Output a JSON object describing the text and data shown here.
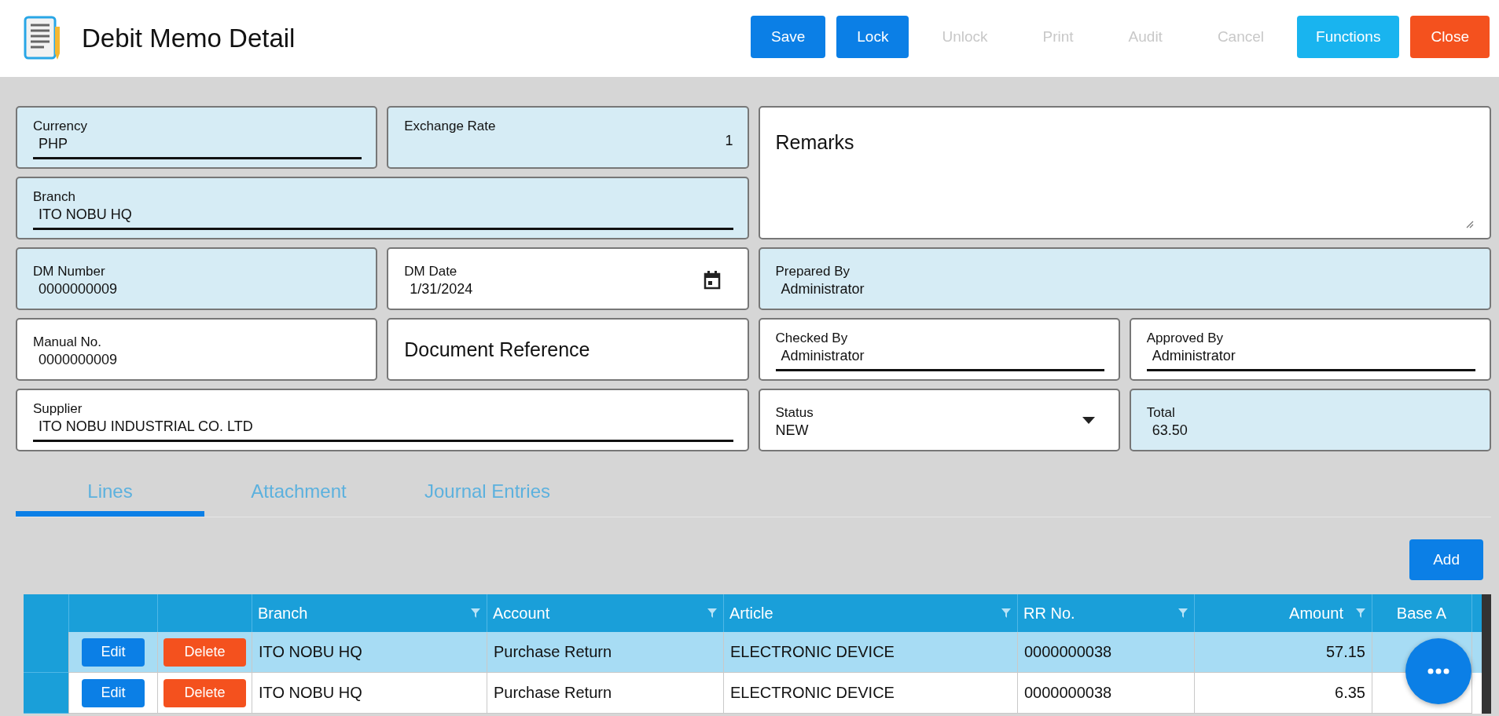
{
  "window": {
    "title": "Debit Memo Detail"
  },
  "toolbar": [
    {
      "label": "Save",
      "disabled": false
    },
    {
      "label": "Lock",
      "disabled": false
    },
    {
      "label": "Unlock",
      "disabled": true
    },
    {
      "label": "Print",
      "disabled": true
    },
    {
      "label": "Audit",
      "disabled": true
    },
    {
      "label": "Cancel",
      "disabled": true
    },
    {
      "label": "Functions",
      "disabled": false
    },
    {
      "label": "Close",
      "disabled": false
    }
  ],
  "fields": [
    {
      "kind": "input",
      "label": "Currency",
      "value": "PHP",
      "readonly": true
    },
    {
      "kind": "number",
      "label": "Exchange Rate",
      "value": "1",
      "readonly": true
    },
    {
      "kind": "textarea",
      "placeholder": "Remarks",
      "readonly": false
    },
    {
      "kind": "input",
      "label": "Branch",
      "value": "ITO NOBU HQ",
      "readonly": true
    },
    {
      "kind": "display",
      "label": "DM Number",
      "value": "0000000009",
      "readonly": true
    },
    {
      "kind": "date",
      "label": "DM Date",
      "value": "1/31/2024",
      "readonly": false
    },
    {
      "kind": "display",
      "label": "Prepared By",
      "value": "Administrator",
      "readonly": true
    },
    {
      "kind": "display",
      "label": "Manual No.",
      "value": "0000000009",
      "readonly": false
    },
    {
      "kind": "empty",
      "placeholder": "Document Reference",
      "readonly": false
    },
    {
      "kind": "input",
      "label": "Checked By",
      "value": "Administrator",
      "readonly": false
    },
    {
      "kind": "input",
      "label": "Approved By",
      "value": "Administrator",
      "readonly": false
    },
    {
      "kind": "input",
      "label": "Supplier",
      "value": "ITO NOBU INDUSTRIAL CO. LTD",
      "readonly": false
    },
    {
      "kind": "select",
      "label": "Status",
      "value": "NEW",
      "readonly": false
    },
    {
      "kind": "display",
      "label": "Total",
      "value": "63.50",
      "readonly": true
    }
  ],
  "tabs": [
    {
      "label": "Lines",
      "selected": true
    },
    {
      "label": "Attachment",
      "selected": false
    },
    {
      "label": "Journal Entries",
      "selected": false
    }
  ],
  "add_button": "Add",
  "table": {
    "columns": [
      {
        "label": "Branch",
        "filter": true
      },
      {
        "label": "Account",
        "filter": true
      },
      {
        "label": "Article",
        "filter": true
      },
      {
        "label": "RR No.",
        "filter": true
      },
      {
        "label": "Amount",
        "filter": true
      },
      {
        "label": "Base A",
        "filter": false
      }
    ],
    "rows": [
      {
        "selected": true,
        "edit": "Edit",
        "delete": "Delete",
        "cells": [
          "ITO NOBU HQ",
          "Purchase Return",
          "ELECTRONIC DEVICE",
          "0000000038",
          "57.15"
        ]
      },
      {
        "selected": false,
        "edit": "Edit",
        "delete": "Delete",
        "cells": [
          "ITO NOBU HQ",
          "Purchase Return",
          "ELECTRONIC DEVICE",
          "0000000038",
          "6.35"
        ]
      }
    ]
  }
}
